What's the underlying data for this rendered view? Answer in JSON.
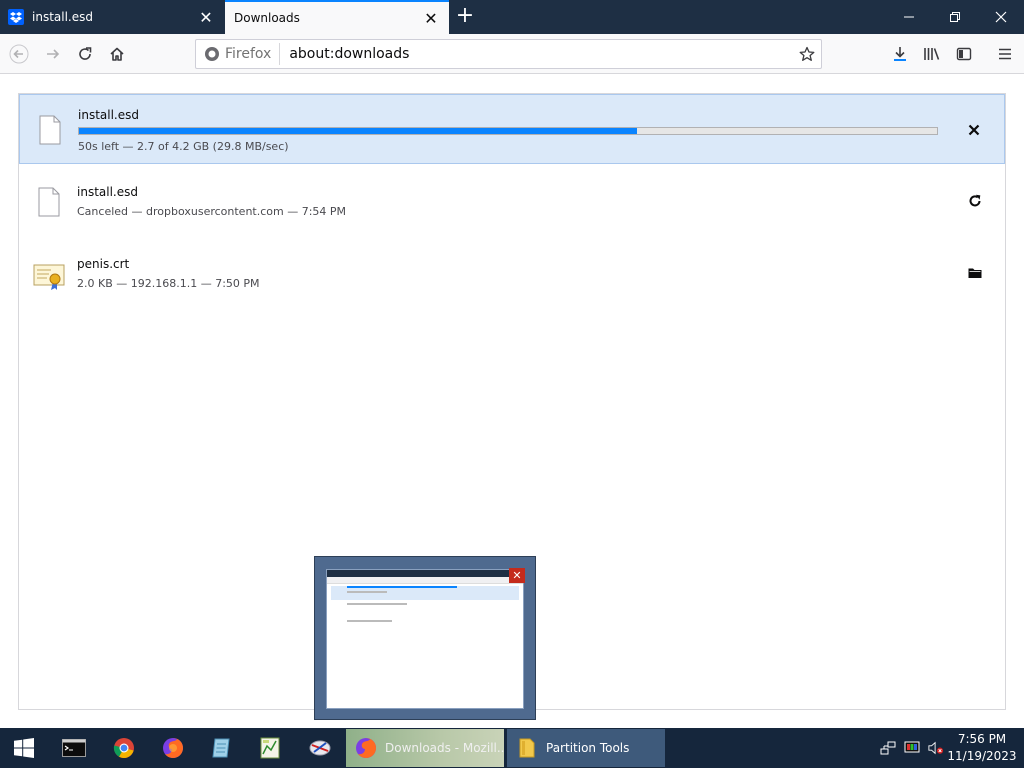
{
  "browser": {
    "tabs": [
      {
        "label": "install.esd",
        "active": false,
        "icon": "dropbox-icon"
      },
      {
        "label": "Downloads",
        "active": true,
        "icon": "none"
      }
    ],
    "new_tab_symbol": "+",
    "url_identity": "Firefox",
    "url": "about:downloads"
  },
  "downloads": [
    {
      "name": "install.esd",
      "status": "50s left — 2.7 of 4.2 GB (29.8 MB/sec)",
      "progress": 0.65,
      "state": "downloading",
      "action_icon": "cancel-icon",
      "file_icon": "file-icon"
    },
    {
      "name": "install.esd",
      "status": "Canceled — dropboxusercontent.com — 7:54 PM",
      "state": "canceled",
      "action_icon": "retry-icon",
      "file_icon": "file-icon"
    },
    {
      "name": "penis.crt",
      "status": "2.0 KB — 192.168.1.1 — 7:50 PM",
      "state": "finished",
      "action_icon": "folder-icon",
      "file_icon": "certificate-icon"
    }
  ],
  "taskbar": {
    "apps": [
      {
        "label": "Downloads - Mozill...",
        "icon": "firefox-icon",
        "active": true
      },
      {
        "label": "Partition Tools",
        "icon": "folder-icon",
        "active": false
      }
    ],
    "pinned_icons": [
      "windows-start-icon",
      "terminal-icon",
      "chrome-icon",
      "firefox-icon",
      "notepad-icon",
      "spreadsheet-icon",
      "tool-icon"
    ],
    "clock_time": "7:56 PM",
    "clock_date": "11/19/2023"
  },
  "colors": {
    "accent": "#0a84ff",
    "tabbar": "#1e2f44",
    "taskbar": "#15263c",
    "selected_row": "#dbe9f9"
  }
}
